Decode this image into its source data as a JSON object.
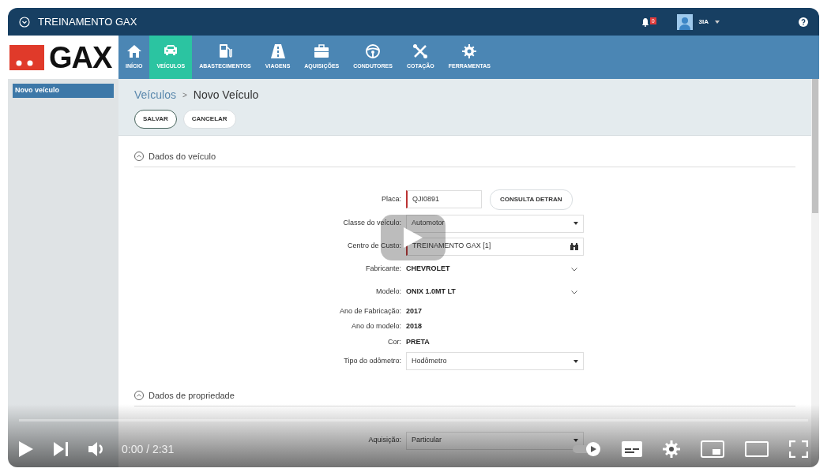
{
  "app": {
    "title": "TREINAMENTO GAX",
    "notifications": "0",
    "user": "3IA",
    "logo": "GAX",
    "nav": [
      {
        "label": "INÍCIO",
        "selected": false
      },
      {
        "label": "VEÍCULOS",
        "selected": true
      },
      {
        "label": "ABASTECIMENTOS",
        "selected": false
      },
      {
        "label": "VIAGENS",
        "selected": false
      },
      {
        "label": "AQUISIÇÕES",
        "selected": false
      },
      {
        "label": "CONDUTORES",
        "selected": false
      },
      {
        "label": "COTAÇÃO",
        "selected": false
      },
      {
        "label": "FERRAMENTAS",
        "selected": false
      }
    ],
    "sidebar": [
      {
        "label": "Novo veículo",
        "selected": true
      }
    ],
    "breadcrumb": {
      "parent": "Veículos",
      "separator": ">",
      "current": "Novo Veículo"
    },
    "actions": [
      "SALVAR",
      "CANCELAR"
    ],
    "sections": [
      {
        "title": "Dados do veículo",
        "expanded": true,
        "fields": [
          {
            "label": "Placa:",
            "kind": "text",
            "value": "QJI0891",
            "button": "CONSULTA DETRAN"
          },
          {
            "label": "Classe do veículo:",
            "kind": "select",
            "value": "Automotor"
          },
          {
            "label": "Centro de Custo:",
            "kind": "lookup",
            "value": "TREINAMENTO GAX [1]"
          },
          {
            "label": "Fabricante:",
            "kind": "dropdown",
            "value": "CHEVROLET"
          },
          {
            "label": "Modelo:",
            "kind": "dropdown",
            "value": "ONIX 1.0MT LT"
          },
          {
            "label": "Ano de Fabricação:",
            "kind": "static",
            "value": "2017"
          },
          {
            "label": "Ano do modelo:",
            "kind": "static",
            "value": "2018"
          },
          {
            "label": "Cor:",
            "kind": "static",
            "value": "PRETA"
          },
          {
            "label": "Tipo do odômetro:",
            "kind": "select",
            "value": "Hodômetro"
          }
        ]
      },
      {
        "title": "Dados de propriedade",
        "expanded": true,
        "fields": [
          {
            "label": "Aquisição:",
            "kind": "select",
            "value": "Particular"
          }
        ]
      }
    ]
  },
  "player": {
    "time": "0:00 / 2:31",
    "level": 0
  }
}
